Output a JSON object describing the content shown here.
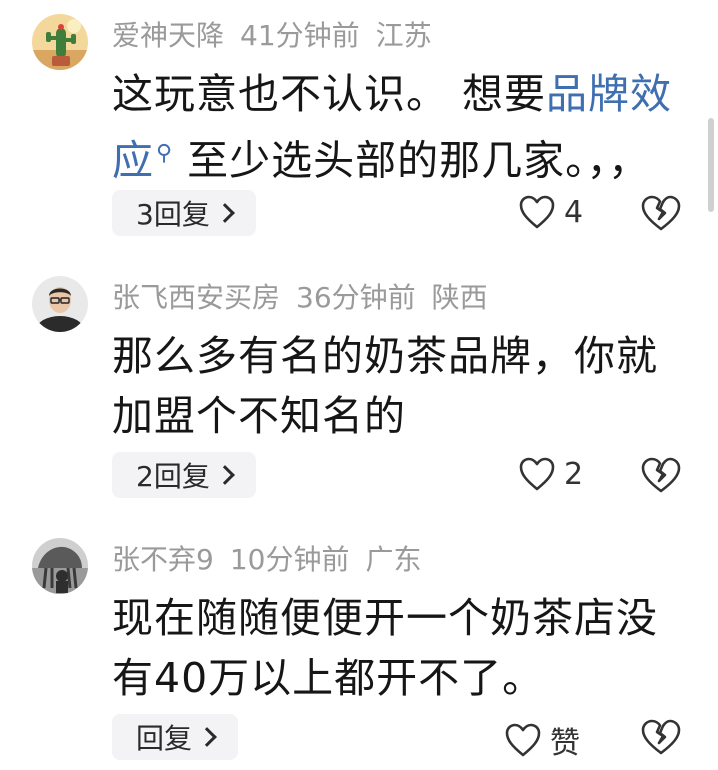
{
  "comments": [
    {
      "username": "爱神天降",
      "time": "41分钟前",
      "location": "江苏",
      "text_line1_a": "这玩意也不认识。 想要",
      "text_link_a": "品牌效",
      "text_link_b": "应",
      "text_line2_rest": "至少选头部的那几家。，，",
      "reply_label": "3回复",
      "like_count": "4"
    },
    {
      "username": "张飞西安买房",
      "time": "36分钟前",
      "location": "陕西",
      "text_line1": "那么多有名的奶茶品牌，你就",
      "text_line2": "加盟个不知名的",
      "reply_label": "2回复",
      "like_count": "2"
    },
    {
      "username": "张不弃9",
      "time": "10分钟前",
      "location": "广东",
      "text_line1": "现在随随便便开一个奶茶店没",
      "text_line2": "有40万以上都开不了。",
      "reply_label": "回复",
      "like_count": "赞"
    }
  ],
  "colors": {
    "meta": "#9a9a9a",
    "text": "#161616",
    "link": "#3f6fb0",
    "reply_bg": "#f3f3f5"
  },
  "icons": {
    "link": "search-glyph-icon",
    "like": "heart-outline-icon",
    "dislike": "broken-heart-icon",
    "reply_arrow": "chevron-right-icon"
  }
}
